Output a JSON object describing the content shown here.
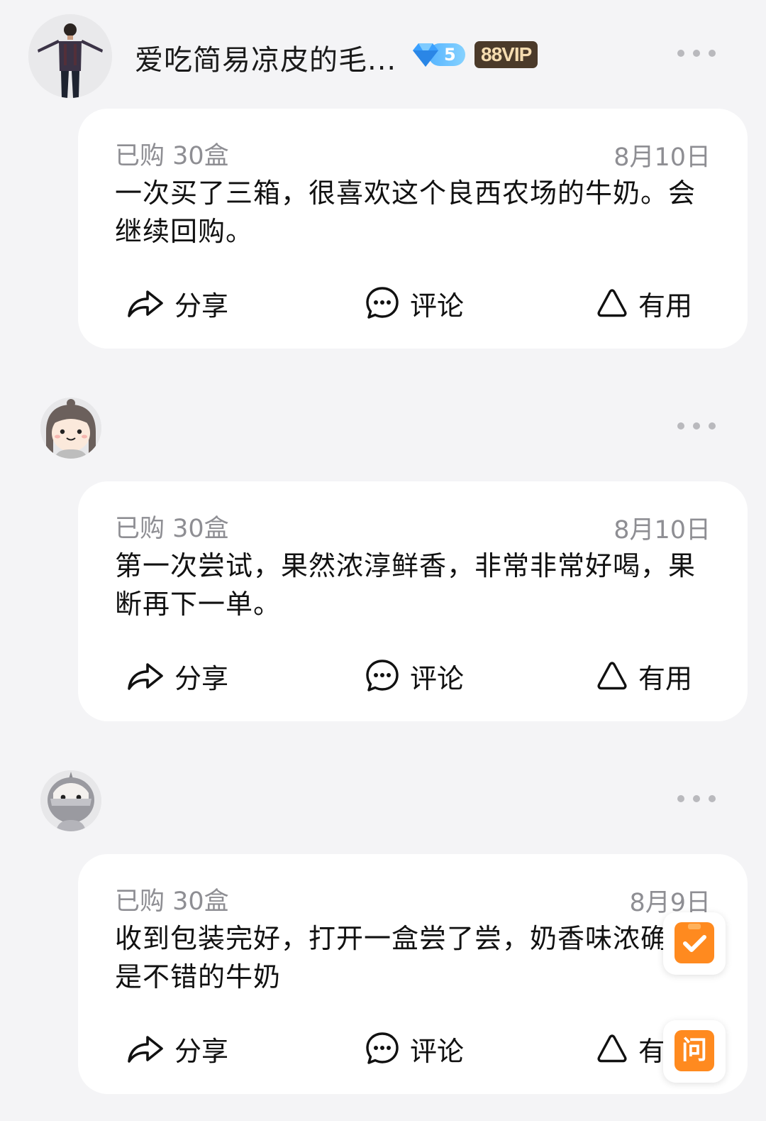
{
  "more_icon": "more-horizontal-icon",
  "reviews": [
    {
      "username": "爱吃简易凉皮的毛...",
      "level_badge": "5",
      "vip_badge": "88VIP",
      "purchase": "已购 30盒",
      "date": "8月10日",
      "content": "一次买了三箱，很喜欢这个良西农场的牛奶。会继续回购。",
      "actions": {
        "share": "分享",
        "comment": "评论",
        "useful": "有用"
      }
    },
    {
      "purchase": "已购 30盒",
      "date": "8月10日",
      "content": "第一次尝试，果然浓淳鲜香，非常非常好喝，果断再下一单。",
      "actions": {
        "share": "分享",
        "comment": "评论",
        "useful": "有用"
      }
    },
    {
      "purchase": "已购 30盒",
      "date": "8月9日",
      "content": "收到包装完好，打开一盒尝了尝，奶香味浓确实是不错的牛奶",
      "actions": {
        "share": "分享",
        "comment": "评论",
        "useful": "有"
      }
    }
  ],
  "floating": {
    "ask_label": "问",
    "check_icon": "checklist-icon"
  },
  "colors": {
    "background": "#f4f4f6",
    "card": "#ffffff",
    "meta_text": "#8e8e93",
    "accent_orange": "#ff8a1f",
    "vip_bg": "#4b3a2a",
    "diamond_blue": "#56b4ff"
  }
}
